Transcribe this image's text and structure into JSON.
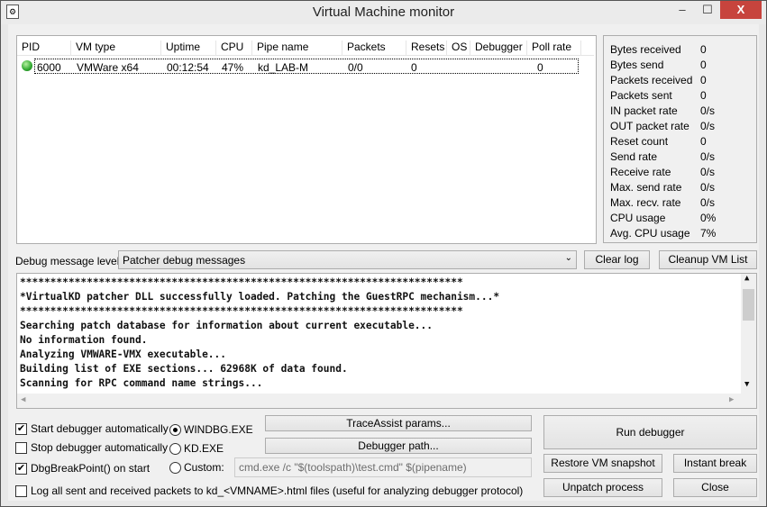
{
  "window": {
    "title": "Virtual Machine monitor",
    "minimize": "–",
    "maximize": "☐",
    "close": "X"
  },
  "vm_list": {
    "columns": [
      "PID",
      "VM type",
      "Uptime",
      "CPU",
      "Pipe name",
      "Packets",
      "Resets",
      "OS",
      "Debugger",
      "Poll rate"
    ],
    "rows": [
      {
        "status_color": "#2fa82f",
        "pid": "6000",
        "vm_type": "VMWare x64",
        "uptime": "00:12:54",
        "cpu": "47%",
        "pipe": "kd_LAB-M",
        "packets": "0/0",
        "resets": "0",
        "os": "",
        "debugger": "",
        "poll_rate": "0"
      }
    ]
  },
  "stats": [
    {
      "label": "Bytes received",
      "value": "0"
    },
    {
      "label": "Bytes send",
      "value": "0"
    },
    {
      "label": "Packets received",
      "value": "0"
    },
    {
      "label": "Packets sent",
      "value": "0"
    },
    {
      "label": "IN packet rate",
      "value": "0/s"
    },
    {
      "label": "OUT packet rate",
      "value": "0/s"
    },
    {
      "label": "Reset count",
      "value": "0"
    },
    {
      "label": "Send rate",
      "value": "0/s"
    },
    {
      "label": "Receive rate",
      "value": "0/s"
    },
    {
      "label": "Max. send rate",
      "value": "0/s"
    },
    {
      "label": "Max. recv. rate",
      "value": "0/s"
    },
    {
      "label": "CPU usage",
      "value": "0%"
    },
    {
      "label": "Avg. CPU usage",
      "value": "7%"
    }
  ],
  "debug": {
    "label": "Debug message level:",
    "selected": "Patcher debug messages",
    "clear_log": "Clear log",
    "cleanup": "Cleanup VM List"
  },
  "log_lines": [
    "*************************************************************************",
    "*VirtualKD patcher DLL successfully loaded. Patching the GuestRPC mechanism...*",
    "*************************************************************************",
    "Searching patch database for information about current executable...",
    "No information found.",
    "Analyzing VMWARE-VMX executable...",
    "Building list of EXE sections... 62968K of data found.",
    "Scanning for RPC command name strings..."
  ],
  "options": {
    "start_auto": "Start debugger automatically",
    "stop_auto": "Stop debugger automatically",
    "dbgbreak": "DbgBreakPoint() on start",
    "log_packets": "Log all sent and received packets to kd_<VMNAME>.html files (useful for analyzing debugger protocol)",
    "start_auto_checked": true,
    "stop_auto_checked": false,
    "dbgbreak_checked": true,
    "log_packets_checked": false
  },
  "debugger": {
    "windbg": "WINDBG.EXE",
    "kd": "KD.EXE",
    "custom": "Custom:",
    "selected": "windbg",
    "custom_cmd": "cmd.exe /c \"$(toolspath)\\test.cmd\" $(pipename)"
  },
  "buttons": {
    "traceassist": "TraceAssist params...",
    "debugger_path": "Debugger path...",
    "run": "Run debugger",
    "restore": "Restore VM snapshot",
    "instant_break": "Instant break",
    "unpatch": "Unpatch process",
    "close": "Close"
  }
}
